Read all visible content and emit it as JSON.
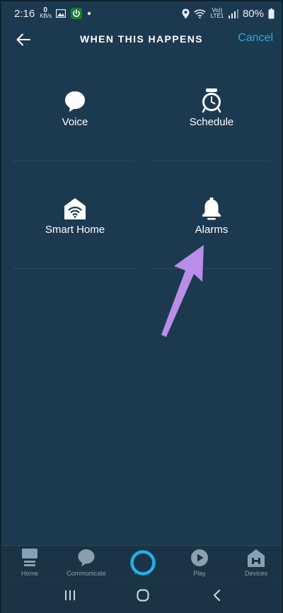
{
  "status_bar": {
    "time": "2:16",
    "data_speed_value": "0",
    "data_speed_unit": "KB/s",
    "carrier_top": "Vo))",
    "carrier_bottom": "LTE1",
    "battery": "80%"
  },
  "header": {
    "title": "WHEN THIS HAPPENS",
    "cancel_label": "Cancel",
    "accent_color": "#1fb1e6"
  },
  "triggers": [
    {
      "label": "Voice",
      "icon": "speech-bubble-icon"
    },
    {
      "label": "Schedule",
      "icon": "alarm-clock-icon"
    },
    {
      "label": "Smart Home",
      "icon": "smart-home-icon"
    },
    {
      "label": "Alarms",
      "icon": "bell-icon"
    }
  ],
  "annotation": {
    "icon": "pointer-arrow",
    "color": "#b88ee8"
  },
  "bottom_nav": {
    "home": "Home",
    "communicate": "Communicate",
    "play": "Play",
    "devices": "Devices"
  },
  "colors": {
    "background": "#1c3a4f",
    "nav_background": "#1a3446",
    "nav_text": "#8aa0b0",
    "alexa_ring": "#1fb1e6"
  }
}
